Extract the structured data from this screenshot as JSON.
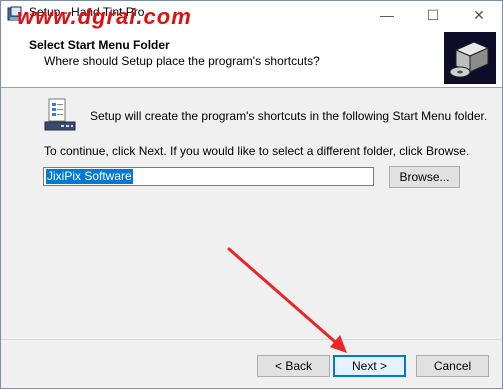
{
  "window": {
    "title": "Setup - Hand Tint Pro",
    "minimize_glyph": "—",
    "maximize_glyph": "☐",
    "close_glyph": "✕"
  },
  "watermark": {
    "text": "www.dgrai.com",
    "color": "#e01010"
  },
  "header": {
    "title": "Select Start Menu Folder",
    "subtitle": "Where should Setup place the program's shortcuts?",
    "logo_icon": "computer-box-icon"
  },
  "body": {
    "icon": "start-menu-folder-icon",
    "info_text": "Setup will create the program's shortcuts in the following Start Menu folder.",
    "instruction_text": "To continue, click Next. If you would like to select a different folder, click Browse.",
    "folder_value": "JixiPix Software",
    "browse_label": "Browse..."
  },
  "footer": {
    "back_label": "< Back",
    "next_label": "Next >",
    "cancel_label": "Cancel"
  },
  "colors": {
    "accent": "#0078d7",
    "arrow": "#e8262a"
  }
}
